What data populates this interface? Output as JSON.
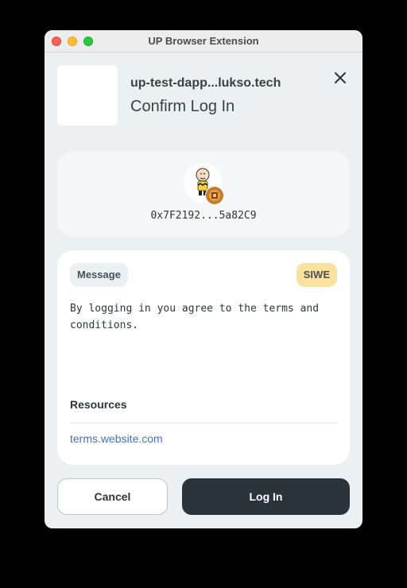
{
  "window": {
    "title": "UP Browser Extension"
  },
  "header": {
    "dapp_name": "up-test-dapp...lukso.tech",
    "confirm_title": "Confirm Log In"
  },
  "profile": {
    "address": "0x7F2192...5a82C9"
  },
  "message": {
    "tag_label": "Message",
    "type_badge": "SIWE",
    "body": "By logging in you agree to the terms and conditions.",
    "resources_title": "Resources",
    "resources": [
      "terms.website.com"
    ]
  },
  "actions": {
    "cancel_label": "Cancel",
    "login_label": "Log In"
  },
  "colors": {
    "window_bg": "#ecf0f3",
    "primary_button": "#2c343b",
    "siwe_badge": "#fbe1a0",
    "link": "#4a70b8"
  },
  "icons": {
    "close": "close-icon",
    "avatar": "profile-avatar",
    "badge": "network-badge-icon"
  }
}
